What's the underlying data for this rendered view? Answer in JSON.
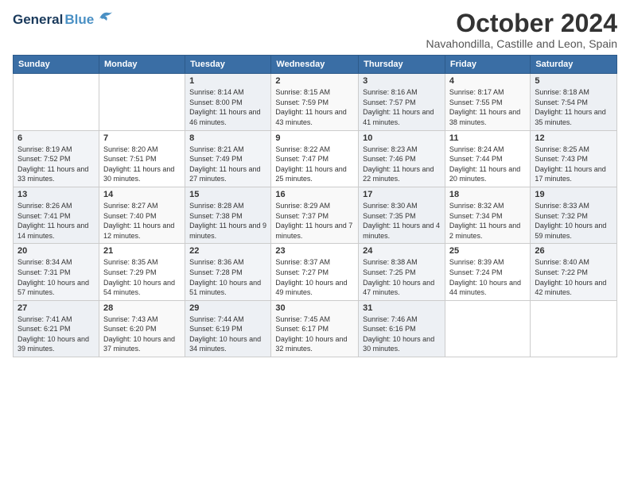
{
  "header": {
    "logo_general": "General",
    "logo_blue": "Blue",
    "main_title": "October 2024",
    "subtitle": "Navahondilla, Castille and Leon, Spain"
  },
  "calendar": {
    "days_of_week": [
      "Sunday",
      "Monday",
      "Tuesday",
      "Wednesday",
      "Thursday",
      "Friday",
      "Saturday"
    ],
    "weeks": [
      [
        {
          "day": "",
          "info": ""
        },
        {
          "day": "",
          "info": ""
        },
        {
          "day": "1",
          "info": "Sunrise: 8:14 AM\nSunset: 8:00 PM\nDaylight: 11 hours and 46 minutes."
        },
        {
          "day": "2",
          "info": "Sunrise: 8:15 AM\nSunset: 7:59 PM\nDaylight: 11 hours and 43 minutes."
        },
        {
          "day": "3",
          "info": "Sunrise: 8:16 AM\nSunset: 7:57 PM\nDaylight: 11 hours and 41 minutes."
        },
        {
          "day": "4",
          "info": "Sunrise: 8:17 AM\nSunset: 7:55 PM\nDaylight: 11 hours and 38 minutes."
        },
        {
          "day": "5",
          "info": "Sunrise: 8:18 AM\nSunset: 7:54 PM\nDaylight: 11 hours and 35 minutes."
        }
      ],
      [
        {
          "day": "6",
          "info": "Sunrise: 8:19 AM\nSunset: 7:52 PM\nDaylight: 11 hours and 33 minutes."
        },
        {
          "day": "7",
          "info": "Sunrise: 8:20 AM\nSunset: 7:51 PM\nDaylight: 11 hours and 30 minutes."
        },
        {
          "day": "8",
          "info": "Sunrise: 8:21 AM\nSunset: 7:49 PM\nDaylight: 11 hours and 27 minutes."
        },
        {
          "day": "9",
          "info": "Sunrise: 8:22 AM\nSunset: 7:47 PM\nDaylight: 11 hours and 25 minutes."
        },
        {
          "day": "10",
          "info": "Sunrise: 8:23 AM\nSunset: 7:46 PM\nDaylight: 11 hours and 22 minutes."
        },
        {
          "day": "11",
          "info": "Sunrise: 8:24 AM\nSunset: 7:44 PM\nDaylight: 11 hours and 20 minutes."
        },
        {
          "day": "12",
          "info": "Sunrise: 8:25 AM\nSunset: 7:43 PM\nDaylight: 11 hours and 17 minutes."
        }
      ],
      [
        {
          "day": "13",
          "info": "Sunrise: 8:26 AM\nSunset: 7:41 PM\nDaylight: 11 hours and 14 minutes."
        },
        {
          "day": "14",
          "info": "Sunrise: 8:27 AM\nSunset: 7:40 PM\nDaylight: 11 hours and 12 minutes."
        },
        {
          "day": "15",
          "info": "Sunrise: 8:28 AM\nSunset: 7:38 PM\nDaylight: 11 hours and 9 minutes."
        },
        {
          "day": "16",
          "info": "Sunrise: 8:29 AM\nSunset: 7:37 PM\nDaylight: 11 hours and 7 minutes."
        },
        {
          "day": "17",
          "info": "Sunrise: 8:30 AM\nSunset: 7:35 PM\nDaylight: 11 hours and 4 minutes."
        },
        {
          "day": "18",
          "info": "Sunrise: 8:32 AM\nSunset: 7:34 PM\nDaylight: 11 hours and 2 minutes."
        },
        {
          "day": "19",
          "info": "Sunrise: 8:33 AM\nSunset: 7:32 PM\nDaylight: 10 hours and 59 minutes."
        }
      ],
      [
        {
          "day": "20",
          "info": "Sunrise: 8:34 AM\nSunset: 7:31 PM\nDaylight: 10 hours and 57 minutes."
        },
        {
          "day": "21",
          "info": "Sunrise: 8:35 AM\nSunset: 7:29 PM\nDaylight: 10 hours and 54 minutes."
        },
        {
          "day": "22",
          "info": "Sunrise: 8:36 AM\nSunset: 7:28 PM\nDaylight: 10 hours and 51 minutes."
        },
        {
          "day": "23",
          "info": "Sunrise: 8:37 AM\nSunset: 7:27 PM\nDaylight: 10 hours and 49 minutes."
        },
        {
          "day": "24",
          "info": "Sunrise: 8:38 AM\nSunset: 7:25 PM\nDaylight: 10 hours and 47 minutes."
        },
        {
          "day": "25",
          "info": "Sunrise: 8:39 AM\nSunset: 7:24 PM\nDaylight: 10 hours and 44 minutes."
        },
        {
          "day": "26",
          "info": "Sunrise: 8:40 AM\nSunset: 7:22 PM\nDaylight: 10 hours and 42 minutes."
        }
      ],
      [
        {
          "day": "27",
          "info": "Sunrise: 7:41 AM\nSunset: 6:21 PM\nDaylight: 10 hours and 39 minutes."
        },
        {
          "day": "28",
          "info": "Sunrise: 7:43 AM\nSunset: 6:20 PM\nDaylight: 10 hours and 37 minutes."
        },
        {
          "day": "29",
          "info": "Sunrise: 7:44 AM\nSunset: 6:19 PM\nDaylight: 10 hours and 34 minutes."
        },
        {
          "day": "30",
          "info": "Sunrise: 7:45 AM\nSunset: 6:17 PM\nDaylight: 10 hours and 32 minutes."
        },
        {
          "day": "31",
          "info": "Sunrise: 7:46 AM\nSunset: 6:16 PM\nDaylight: 10 hours and 30 minutes."
        },
        {
          "day": "",
          "info": ""
        },
        {
          "day": "",
          "info": ""
        }
      ]
    ]
  }
}
